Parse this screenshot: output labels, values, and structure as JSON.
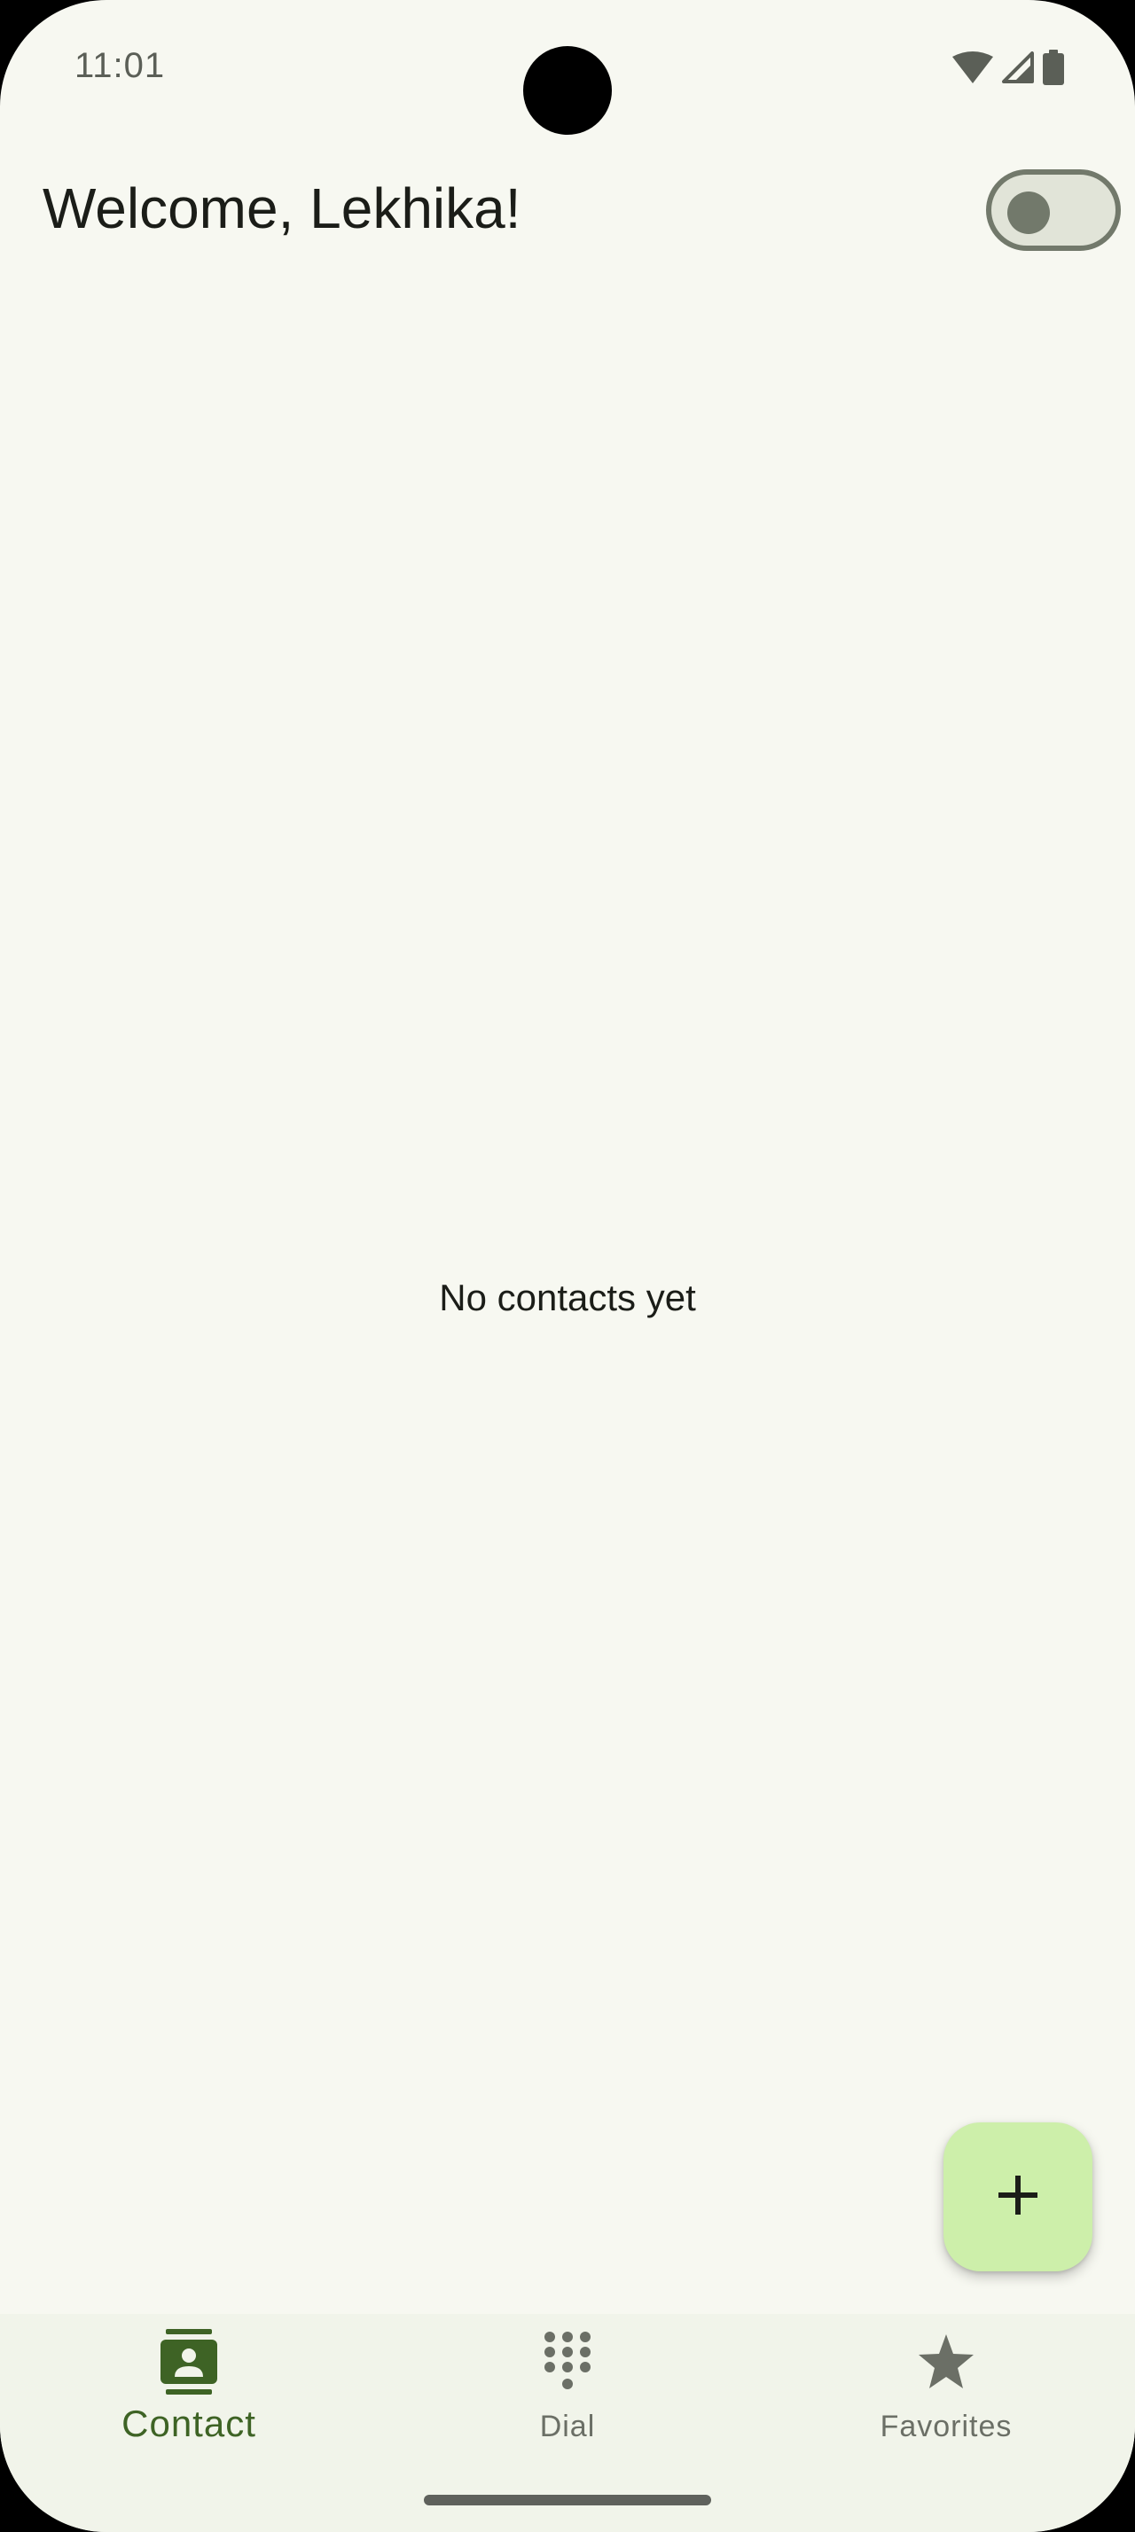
{
  "status_bar": {
    "time": "11:01",
    "icons": [
      "wifi-icon",
      "cellular-signal-icon",
      "battery-icon"
    ]
  },
  "header": {
    "title": "Welcome, Lekhika!",
    "theme_toggle_on": false
  },
  "main": {
    "empty_message": "No contacts yet"
  },
  "fab": {
    "icon": "plus-icon"
  },
  "bottom_nav": {
    "items": [
      {
        "label": "Contact",
        "icon": "contact-icon",
        "active": true
      },
      {
        "label": "Dial",
        "icon": "dialpad-icon",
        "active": false
      },
      {
        "label": "Favorites",
        "icon": "star-icon",
        "active": false
      }
    ]
  },
  "colors": {
    "background": "#f7f8f1",
    "accent": "#3e6325",
    "fab_background": "#cdefaa",
    "nav_background": "#f1f4ea"
  }
}
